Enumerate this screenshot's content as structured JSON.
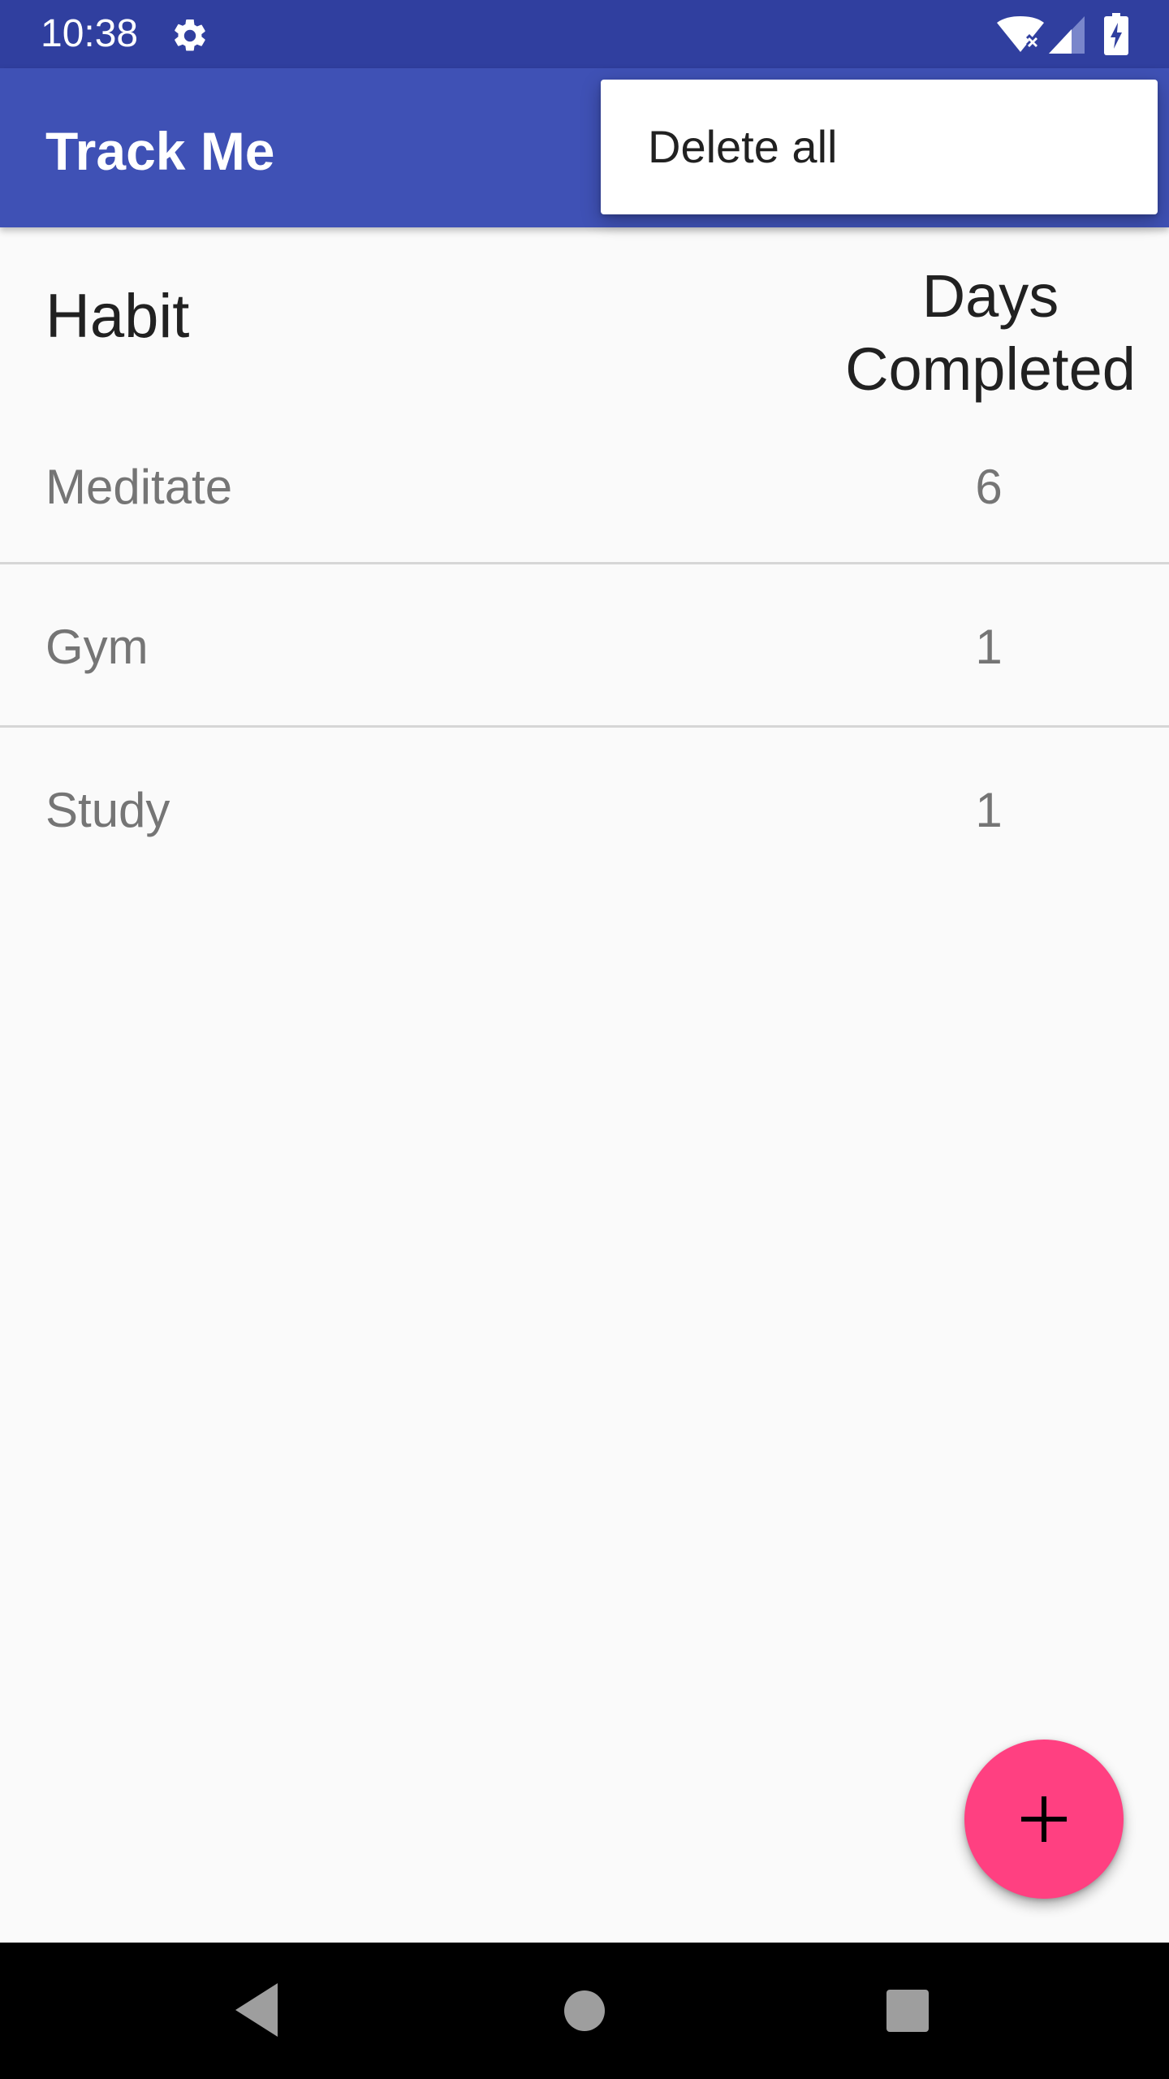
{
  "status_bar": {
    "time": "10:38",
    "icons": [
      "gear-icon",
      "wifi-icon",
      "signal-icon",
      "battery-charging-icon"
    ]
  },
  "app_bar": {
    "title": "Track Me"
  },
  "menu": {
    "items": [
      {
        "label": "Delete all"
      }
    ]
  },
  "table": {
    "columns": [
      "Habit",
      "Days\nCompleted"
    ],
    "header_habit": "Habit",
    "header_days": "Days Completed",
    "rows": [
      {
        "habit": "Meditate",
        "days": "6"
      },
      {
        "habit": "Gym",
        "days": "1"
      },
      {
        "habit": "Study",
        "days": "1"
      }
    ]
  },
  "fab": {
    "icon": "plus-icon"
  },
  "nav_bar": {
    "icons": [
      "back-icon",
      "home-icon",
      "recents-icon"
    ]
  },
  "colors": {
    "primary": "#3f51b5",
    "primary_dark": "#303f9f",
    "accent": "#ff4081",
    "background": "#fafafa"
  }
}
